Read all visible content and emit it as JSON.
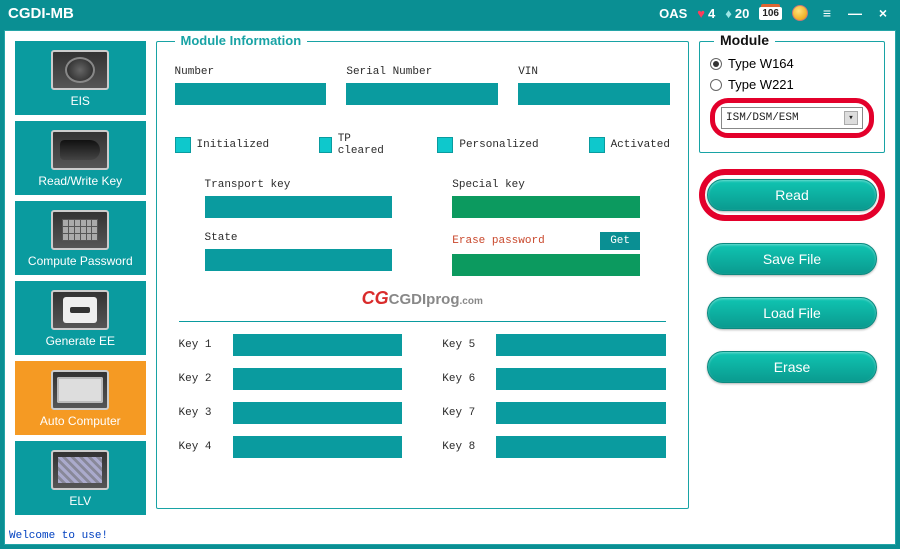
{
  "titlebar": {
    "title": "CGDI-MB",
    "oas": "OAS",
    "hearts": "4",
    "diamonds": "20",
    "calendar": "106"
  },
  "sidebar": {
    "items": [
      {
        "label": "EIS"
      },
      {
        "label": "Read/Write Key"
      },
      {
        "label": "Compute Password"
      },
      {
        "label": "Generate EE"
      },
      {
        "label": "Auto Computer"
      },
      {
        "label": "ELV"
      }
    ]
  },
  "module_info": {
    "legend": "Module Information",
    "number_label": "Number",
    "serial_label": "Serial Number",
    "vin_label": "VIN",
    "chk_initialized": "Initialized",
    "chk_tp": "TP cleared",
    "chk_personalized": "Personalized",
    "chk_activated": "Activated",
    "transport_key": "Transport key",
    "special_key": "Special key",
    "state": "State",
    "erase_password": "Erase password",
    "get": "Get",
    "watermark_brand": "CG",
    "watermark_text": "CGDIprog",
    "watermark_suffix": ".com",
    "keys": [
      "Key 1",
      "Key 2",
      "Key 3",
      "Key 4",
      "Key 5",
      "Key 6",
      "Key 7",
      "Key 8"
    ]
  },
  "module_panel": {
    "legend": "Module",
    "radio1": "Type W164",
    "radio2": "Type W221",
    "select_value": "ISM/DSM/ESM",
    "btn_read": "Read",
    "btn_save": "Save File",
    "btn_load": "Load File",
    "btn_erase": "Erase"
  },
  "status": "Welcome to use!"
}
